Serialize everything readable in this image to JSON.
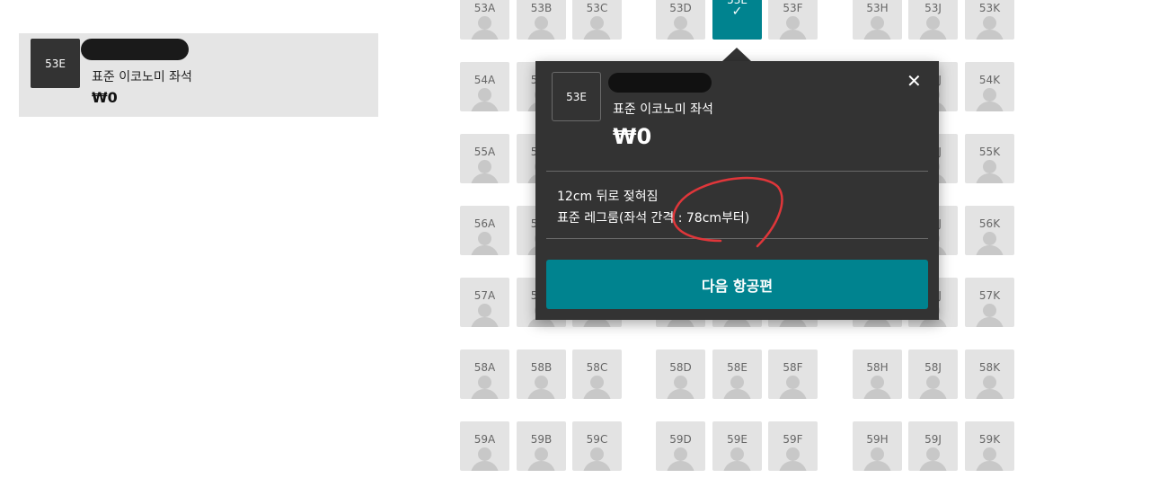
{
  "selection_summary": {
    "seat_code": "53E",
    "seat_type": "표준 이코노미 좌석",
    "price": "₩0"
  },
  "columns": [
    "A",
    "B",
    "C",
    "D",
    "E",
    "F",
    "H",
    "J",
    "K"
  ],
  "rows": [
    "53",
    "54",
    "55",
    "56",
    "57",
    "58",
    "59"
  ],
  "selected_seat": "53E",
  "popup": {
    "seat_code": "53E",
    "seat_type": "표준 이코노미 좌석",
    "price": "₩0",
    "close_glyph": "✕",
    "features": [
      "12cm 뒤로 젖혀짐",
      "표준 레그룸(좌석 간격 : 78cm부터)"
    ],
    "next_button": "다음 항공편"
  },
  "colors": {
    "accent": "#00838f",
    "popup_bg": "#333333",
    "seat_bg": "#e3e3e3",
    "annotation": "#e0363a"
  },
  "icons": {
    "seat": "person-icon",
    "selected": "check-icon",
    "close": "close-icon"
  }
}
